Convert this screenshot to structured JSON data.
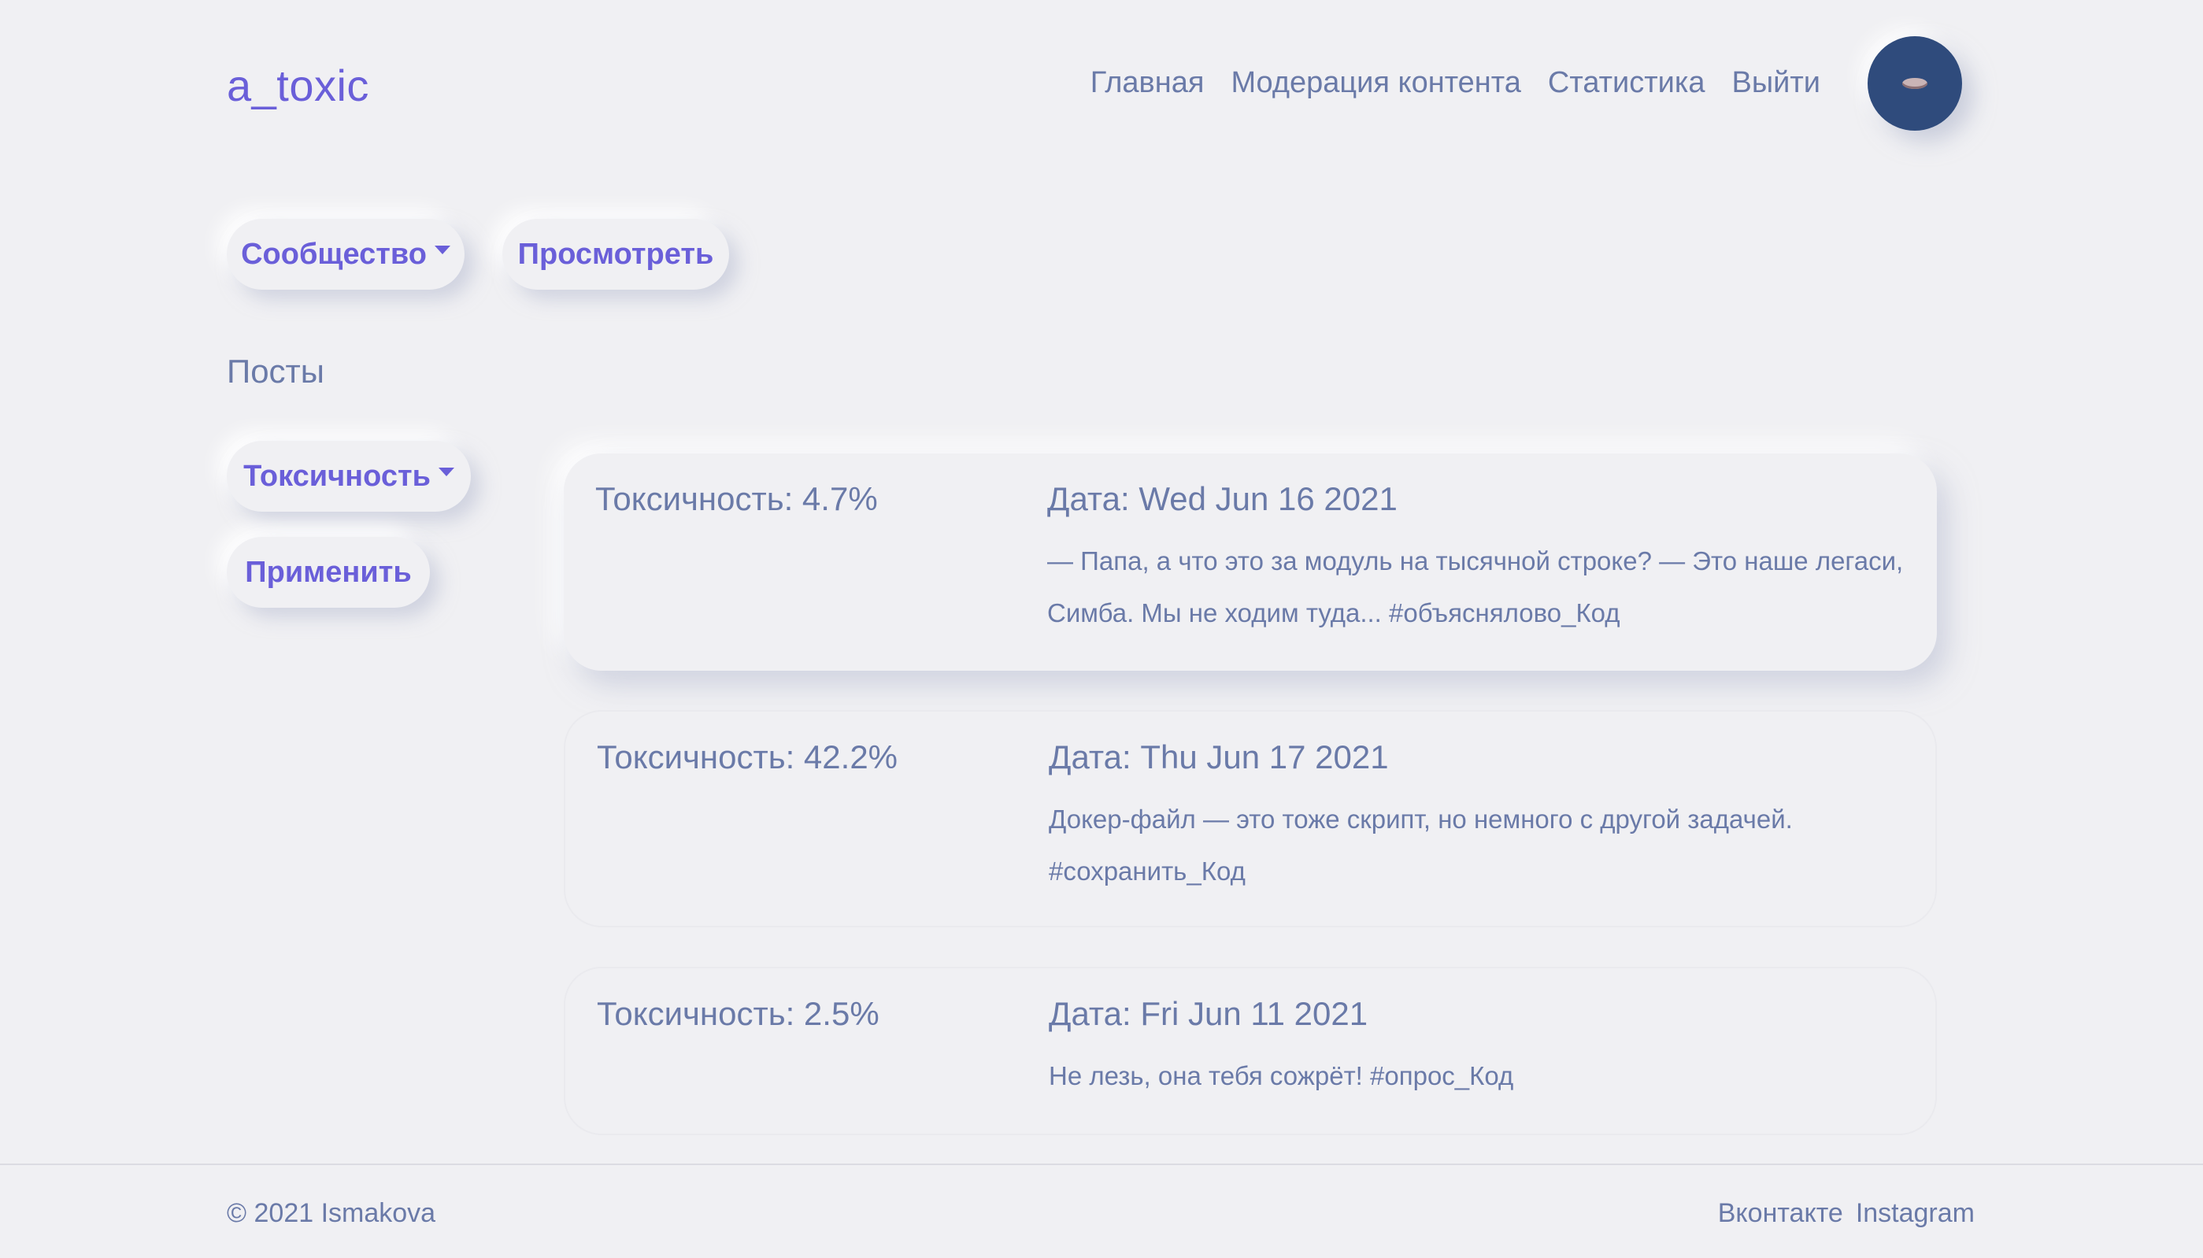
{
  "header": {
    "brand": "a_toxic",
    "nav": [
      "Главная",
      "Модерация контента",
      "Статистика",
      "Выйти"
    ],
    "avatar_color": "#2f4b7c"
  },
  "controls": {
    "community_label": "Сообщество",
    "view_label": "Просмотреть",
    "toxicity_label": "Токсичность",
    "apply_label": "Применить"
  },
  "section_title": "Посты",
  "posts": [
    {
      "toxicity": "Токсичность: 4.7%",
      "date": "Дата: Wed Jun 16 2021",
      "text": "— Папа, а что это за модуль на тысячной строке? — Это наше легаси, Симба. Мы не ходим туда... #объяснялово_Код"
    },
    {
      "toxicity": "Токсичность: 42.2%",
      "date": "Дата: Thu Jun 17 2021",
      "text": "Докер-файл — это тоже скрипт, но немного с другой задачей. #сохранить_Код"
    },
    {
      "toxicity": "Токсичность: 2.5%",
      "date": "Дата: Fri Jun 11 2021",
      "text": "Не лезь, она тебя сожрёт! #опрос_Код"
    }
  ],
  "footer": {
    "copyright": "© 2021 Ismakova",
    "links": [
      "Вконтакте",
      "Instagram"
    ]
  },
  "colors": {
    "accent": "#6a5fd9",
    "text": "#6a7aa8",
    "background": "#f0f0f3"
  }
}
